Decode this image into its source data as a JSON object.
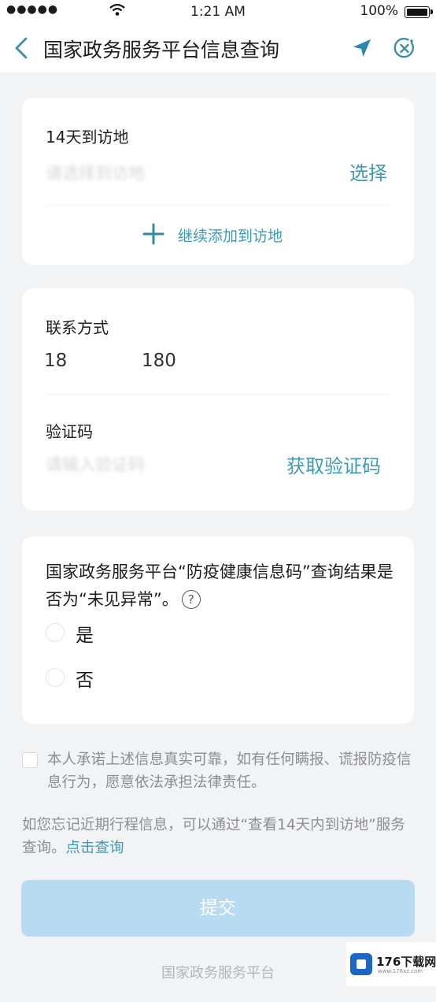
{
  "status_bar": {
    "signal": "●●●●●",
    "time": "1:21 AM",
    "battery": "100%"
  },
  "nav": {
    "title": "国家政务服务平台信息查询",
    "icons": [
      "back-arrow-icon",
      "location-arrow-icon",
      "close-circle-icon"
    ]
  },
  "visit_card": {
    "label": "14天到访地",
    "placeholder": "请选择到访地",
    "select_label": "选择",
    "add_more_label": "继续添加到访地"
  },
  "contact_card": {
    "phone_label": "联系方式",
    "phone_prefix": "18",
    "phone_suffix": "180",
    "code_label": "验证码",
    "code_placeholder": "请输入验证码",
    "get_code_label": "获取验证码"
  },
  "question_card": {
    "question": "国家政务服务平台“防疫健康信息码”查询结果是否为“未见异常”。",
    "help_icon": "?",
    "options": [
      "是",
      "否"
    ]
  },
  "pledge_text": "本人承诺上述信息真实可靠，如有任何瞒报、谎报防疫信息行为，愿意依法承担法律责任。",
  "hint": {
    "text": "如您忘记近期行程信息，可以通过“查看14天内到访地”服务查询。",
    "link": "点击查询"
  },
  "submit_label": "提交",
  "footer": "国家政务服务平台",
  "watermark": {
    "text": "176下载网",
    "sub": "www.176xz.com"
  },
  "colors": {
    "accent": "#3b9bb7",
    "submit_disabled": "#b9dbf2",
    "background": "#f2f3f5"
  }
}
